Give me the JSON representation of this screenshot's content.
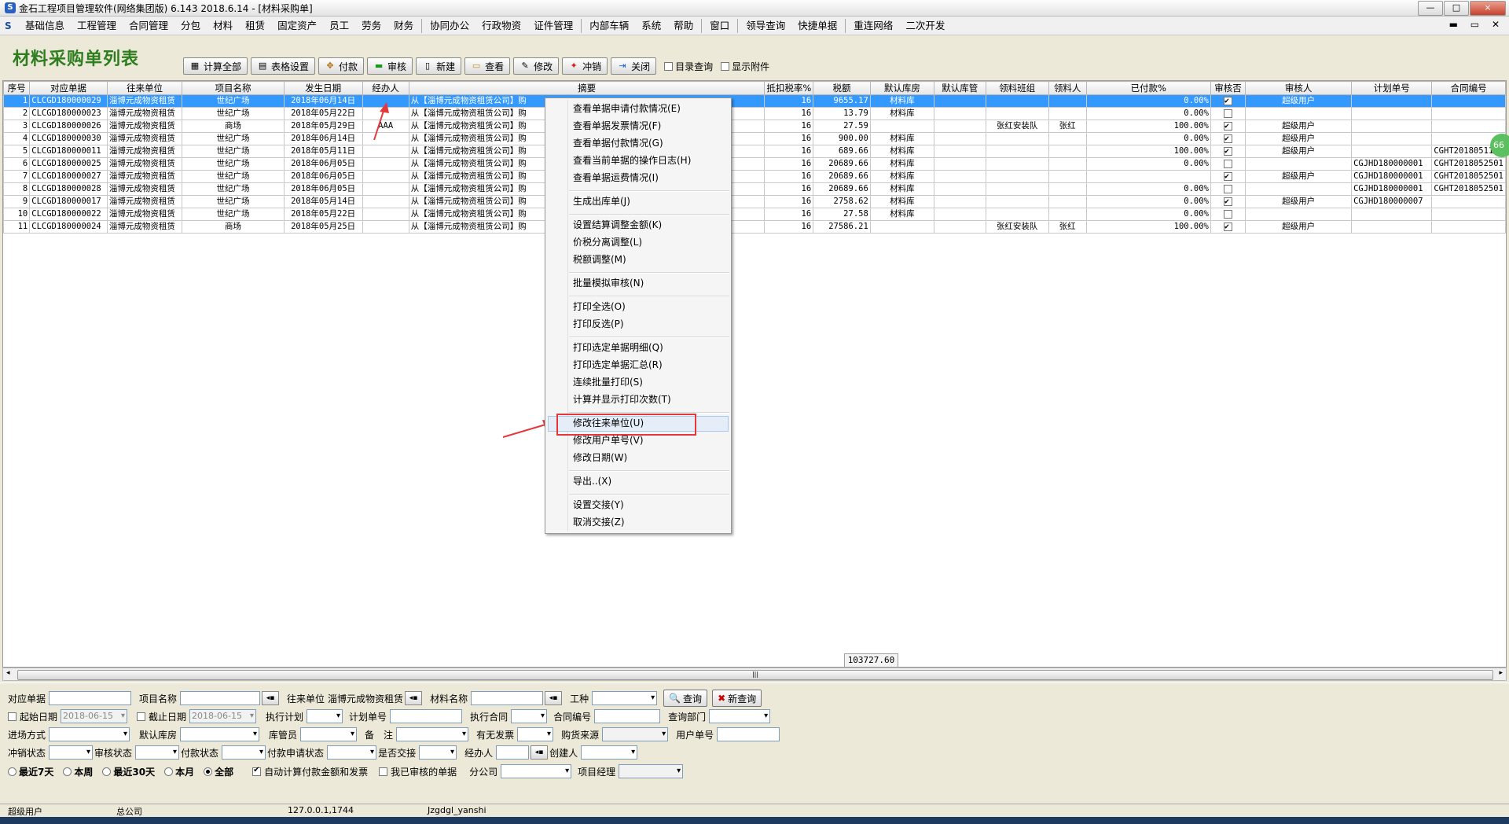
{
  "window": {
    "title": "金石工程项目管理软件(网络集团版) 6.143  2018.6.14 - [材料采购单]",
    "app_icon": "S",
    "buttons": [
      "—",
      "□",
      "×"
    ]
  },
  "menubar": {
    "logo": "S",
    "items": [
      "基础信息",
      "工程管理",
      "合同管理",
      "分包",
      "材料",
      "租赁",
      "固定资产",
      "员工",
      "劳务",
      "财务",
      "协同办公",
      "行政物资",
      "证件管理",
      "内部车辆",
      "系统",
      "帮助",
      "窗口",
      "领导查询",
      "快捷单据",
      "重连网络",
      "二次开发"
    ],
    "mdi_controls": "▬ ▭ ✕"
  },
  "toolbar": {
    "page_title": "材料采购单列表",
    "buttons": [
      {
        "label": "计算全部",
        "icon": "calculator-icon",
        "glyph": "▦"
      },
      {
        "label": "表格设置",
        "icon": "table-icon",
        "glyph": "▤"
      },
      {
        "label": "付款",
        "icon": "payment-icon",
        "glyph": "✥"
      },
      {
        "label": "审核",
        "icon": "approve-icon",
        "glyph": "▬"
      },
      {
        "label": "新建",
        "icon": "new-doc-icon",
        "glyph": "▯"
      },
      {
        "label": "查看",
        "icon": "folder-icon",
        "glyph": "▭"
      },
      {
        "label": "修改",
        "icon": "edit-icon",
        "glyph": "✎"
      },
      {
        "label": "冲销",
        "icon": "writeoff-icon",
        "glyph": "✦"
      },
      {
        "label": "关闭",
        "icon": "exit-icon",
        "glyph": "⇥"
      }
    ],
    "checkboxes": [
      {
        "label": "目录查询",
        "checked": false
      },
      {
        "label": "显示附件",
        "checked": false
      }
    ]
  },
  "grid": {
    "columns": [
      "序号",
      "对应单据",
      "往来单位",
      "项目名称",
      "发生日期",
      "经办人",
      "摘要",
      "抵扣税率%",
      "税额",
      "默认库房",
      "默认库管",
      "领料班组",
      "领料人",
      "已付款%",
      "审核否",
      "审核人",
      "计划单号",
      "合同编号"
    ],
    "rows": [
      {
        "no": "1",
        "doc": "CLCGD180000029",
        "unit": "淄博元成物资租赁",
        "project": "世纪广场",
        "date": "2018年06月14日",
        "handler": "",
        "summary": "从【淄博元成物资租赁公司】购",
        "rate": "16",
        "tax": "9655.17",
        "store": "材料库",
        "keeper": "",
        "team": "",
        "picker": "",
        "paid": "0.00%",
        "audited": true,
        "auditor": "超级用户",
        "plan": "",
        "contract": "",
        "selected": true
      },
      {
        "no": "2",
        "doc": "CLCGD180000023",
        "unit": "淄博元成物资租赁",
        "project": "世纪广场",
        "date": "2018年05月22日",
        "handler": "",
        "summary": "从【淄博元成物资租赁公司】购",
        "rate": "16",
        "tax": "13.79",
        "store": "材料库",
        "keeper": "",
        "team": "",
        "picker": "",
        "paid": "0.00%",
        "audited": false,
        "auditor": "",
        "plan": "",
        "contract": ""
      },
      {
        "no": "3",
        "doc": "CLCGD180000026",
        "unit": "淄博元成物资租赁",
        "project": "商场",
        "date": "2018年05月29日",
        "handler": "AAA",
        "summary": "从【淄博元成物资租赁公司】购",
        "rate": "16",
        "tax": "27.59",
        "store": "",
        "keeper": "",
        "team": "张红安装队",
        "picker": "张红",
        "paid": "100.00%",
        "audited": true,
        "auditor": "超级用户",
        "plan": "",
        "contract": ""
      },
      {
        "no": "4",
        "doc": "CLCGD180000030",
        "unit": "淄博元成物资租赁",
        "project": "世纪广场",
        "date": "2018年06月14日",
        "handler": "",
        "summary": "从【淄博元成物资租赁公司】购",
        "rate": "16",
        "tax": "900.00",
        "store": "材料库",
        "keeper": "",
        "team": "",
        "picker": "",
        "paid": "0.00%",
        "audited": true,
        "auditor": "超级用户",
        "plan": "",
        "contract": ""
      },
      {
        "no": "5",
        "doc": "CLCGD180000011",
        "unit": "淄博元成物资租赁",
        "project": "世纪广场",
        "date": "2018年05月11日",
        "handler": "",
        "summary": "从【淄博元成物资租赁公司】购",
        "rate": "16",
        "tax": "689.66",
        "store": "材料库",
        "keeper": "",
        "team": "",
        "picker": "",
        "paid": "100.00%",
        "audited": true,
        "auditor": "超级用户",
        "plan": "",
        "contract": "CGHT20180511"
      },
      {
        "no": "6",
        "doc": "CLCGD180000025",
        "unit": "淄博元成物资租赁",
        "project": "世纪广场",
        "date": "2018年06月05日",
        "handler": "",
        "summary": "从【淄博元成物资租赁公司】购",
        "rate": "16",
        "tax": "20689.66",
        "store": "材料库",
        "keeper": "",
        "team": "",
        "picker": "",
        "paid": "0.00%",
        "audited": false,
        "auditor": "",
        "plan": "CGJHD180000001",
        "contract": "CGHT2018052501"
      },
      {
        "no": "7",
        "doc": "CLCGD180000027",
        "unit": "淄博元成物资租赁",
        "project": "世纪广场",
        "date": "2018年06月05日",
        "handler": "",
        "summary": "从【淄博元成物资租赁公司】购",
        "rate": "16",
        "tax": "20689.66",
        "store": "材料库",
        "keeper": "",
        "team": "",
        "picker": "",
        "paid": "",
        "audited": true,
        "auditor": "超级用户",
        "plan": "CGJHD180000001",
        "contract": "CGHT2018052501"
      },
      {
        "no": "8",
        "doc": "CLCGD180000028",
        "unit": "淄博元成物资租赁",
        "project": "世纪广场",
        "date": "2018年06月05日",
        "handler": "",
        "summary": "从【淄博元成物资租赁公司】购",
        "rate": "16",
        "tax": "20689.66",
        "store": "材料库",
        "keeper": "",
        "team": "",
        "picker": "",
        "paid": "0.00%",
        "audited": false,
        "auditor": "",
        "plan": "CGJHD180000001",
        "contract": "CGHT2018052501"
      },
      {
        "no": "9",
        "doc": "CLCGD180000017",
        "unit": "淄博元成物资租赁",
        "project": "世纪广场",
        "date": "2018年05月14日",
        "handler": "",
        "summary": "从【淄博元成物资租赁公司】购",
        "rate": "16",
        "tax": "2758.62",
        "store": "材料库",
        "keeper": "",
        "team": "",
        "picker": "",
        "paid": "0.00%",
        "audited": true,
        "auditor": "超级用户",
        "plan": "CGJHD180000007",
        "contract": ""
      },
      {
        "no": "10",
        "doc": "CLCGD180000022",
        "unit": "淄博元成物资租赁",
        "project": "世纪广场",
        "date": "2018年05月22日",
        "handler": "",
        "summary": "从【淄博元成物资租赁公司】购",
        "rate": "16",
        "tax": "27.58",
        "store": "材料库",
        "keeper": "",
        "team": "",
        "picker": "",
        "paid": "0.00%",
        "audited": false,
        "auditor": "",
        "plan": "",
        "contract": ""
      },
      {
        "no": "11",
        "doc": "CLCGD180000024",
        "unit": "淄博元成物资租赁",
        "project": "商场",
        "date": "2018年05月25日",
        "handler": "",
        "summary": "从【淄博元成物资租赁公司】购",
        "rate": "16",
        "tax": "27586.21",
        "store": "",
        "keeper": "",
        "team": "张红安装队",
        "picker": "张红",
        "paid": "100.00%",
        "audited": true,
        "auditor": "超级用户",
        "plan": "",
        "contract": ""
      }
    ],
    "total_tax": "103727.60",
    "badge": "66"
  },
  "context_menu": {
    "groups": [
      [
        "查看单据申请付款情况(E)",
        "查看单据发票情况(F)",
        "查看单据付款情况(G)",
        "查看当前单据的操作日志(H)",
        "查看单据运费情况(I)"
      ],
      [
        "生成出库单(J)"
      ],
      [
        "设置结算调整金额(K)",
        "价税分离调整(L)",
        "税额调整(M)"
      ],
      [
        "批量模拟审核(N)"
      ],
      [
        "打印全选(O)",
        "打印反选(P)"
      ],
      [
        "打印选定单据明细(Q)",
        "打印选定单据汇总(R)",
        "连续批量打印(S)",
        "计算并显示打印次数(T)"
      ],
      [
        "修改往来单位(U)",
        "修改用户单号(V)",
        "修改日期(W)"
      ],
      [
        "导出..(X)"
      ],
      [
        "设置交接(Y)",
        "取消交接(Z)"
      ]
    ],
    "highlighted": "修改往来单位(U)",
    "highlight_color": "#e5383b"
  },
  "filters": {
    "doc_label": "对应单据",
    "project_label": "项目名称",
    "unit_label": "往来单位",
    "unit_value": "淄博元成物资租赁",
    "material_label": "材料名称",
    "worktype_label": "工种",
    "query_btn": "查询",
    "newquery_btn": "新查询",
    "start_label": "起始日期",
    "start_value": "2018-06-15",
    "end_label": "截止日期",
    "end_value": "2018-06-15",
    "execplan_label": "执行计划",
    "planno_label": "计划单号",
    "execcontract_label": "执行合同",
    "contractno_label": "合同编号",
    "dept_label": "查询部门",
    "entry_label": "进场方式",
    "store_label": "默认库房",
    "keeper_label": "库管员",
    "remark_label": "备　注",
    "invoice_label": "有无发票",
    "source_label": "购货来源",
    "userno_label": "用户单号",
    "writeoff_label": "冲销状态",
    "audit_label": "审核状态",
    "pay_label": "付款状态",
    "payreq_label": "付款申请状态",
    "handover_label": "是否交接",
    "handler_label": "经办人",
    "creator_label": "创建人",
    "radios": [
      {
        "label": "最近7天",
        "on": false
      },
      {
        "label": "本周",
        "on": false
      },
      {
        "label": "最近30天",
        "on": false
      },
      {
        "label": "本月",
        "on": false
      },
      {
        "label": "全部",
        "on": true
      }
    ],
    "auto_calc_label": "自动计算付款金额和发票",
    "auto_calc_on": true,
    "audited_only_label": "我已审核的单据",
    "audited_only_on": false,
    "branch_label": "分公司",
    "pm_label": "项目经理"
  },
  "statusbar": {
    "user": "超级用户",
    "company": "总公司",
    "ip": "127.0.0.1,1744",
    "db": "Jzgdgl_yanshi"
  },
  "colors": {
    "title_green": "#2e7d1e",
    "selection": "#3399ff",
    "annotation_red": "#e5383b"
  }
}
